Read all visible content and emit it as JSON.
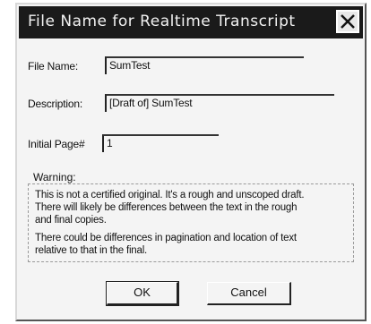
{
  "dialog": {
    "title": "File Name for Realtime Transcript",
    "close_glyph": "✕"
  },
  "fields": {
    "file_name_label": "File Name:",
    "file_name_value": "SumTest",
    "description_label": "Description:",
    "description_value": "[Draft of] SumTest",
    "initial_page_label": "Initial Page#",
    "initial_page_value": "1"
  },
  "warning": {
    "legend": "Warning:",
    "line1": "This is not a certified original. It's a rough and unscoped draft.",
    "line2": "There will likely be differences between the text in the rough",
    "line3": "and final copies.",
    "line4": "There could be differences in pagination and location of text",
    "line5": "relative to that in the final."
  },
  "buttons": {
    "ok": "OK",
    "cancel": "Cancel"
  }
}
